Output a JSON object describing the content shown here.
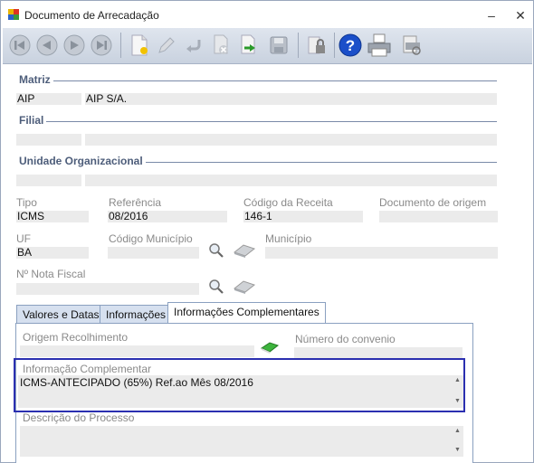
{
  "window": {
    "title": "Documento de Arrecadação",
    "minimize_glyph": "–",
    "close_glyph": "✕"
  },
  "toolbar": {
    "icons": [
      "first-record-icon",
      "previous-record-icon",
      "next-record-icon",
      "last-record-icon",
      "new-document-icon",
      "edit-icon",
      "undo-icon",
      "delete-icon",
      "export-icon",
      "save-icon",
      "lock-icon",
      "help-icon",
      "print-icon",
      "print-preview-icon"
    ]
  },
  "matriz": {
    "title": "Matriz",
    "code": "AIP",
    "name": "AIP S/A."
  },
  "filial": {
    "title": "Filial",
    "code": "",
    "name": ""
  },
  "unidade": {
    "title": "Unidade Organizacional",
    "code": "",
    "name": ""
  },
  "fields": {
    "tipo_label": "Tipo",
    "tipo_value": "ICMS",
    "referencia_label": "Referência",
    "referencia_value": "08/2016",
    "codigo_receita_label": "Código da Receita",
    "codigo_receita_value": "146-1",
    "documento_origem_label": "Documento de origem",
    "documento_origem_value": "",
    "uf_label": "UF",
    "uf_value": "BA",
    "codigo_municipio_label": "Código Município",
    "codigo_municipio_value": "",
    "municipio_label": "Município",
    "municipio_value": "",
    "nota_fiscal_label": "Nº Nota Fiscal",
    "nota_fiscal_value": ""
  },
  "tabs": [
    {
      "label": "Valores e Datas",
      "active": false
    },
    {
      "label": "Informações",
      "active": false
    },
    {
      "label": "Informações Complementares",
      "active": true
    }
  ],
  "complementares": {
    "origem_label": "Origem Recolhimento",
    "origem_value": "",
    "convenio_label": "Número do convenio",
    "convenio_value": "",
    "info_label": "Informação Complementar",
    "info_value": "ICMS-ANTECIPADO (65%) Ref.ao Mês 08/2016",
    "descricao_label": "Descrição do Processo",
    "descricao_value": ""
  },
  "colors": {
    "highlight_border": "#2b2fb0",
    "group_title": "#4d5d7a",
    "field_bg": "#ebebeb"
  }
}
